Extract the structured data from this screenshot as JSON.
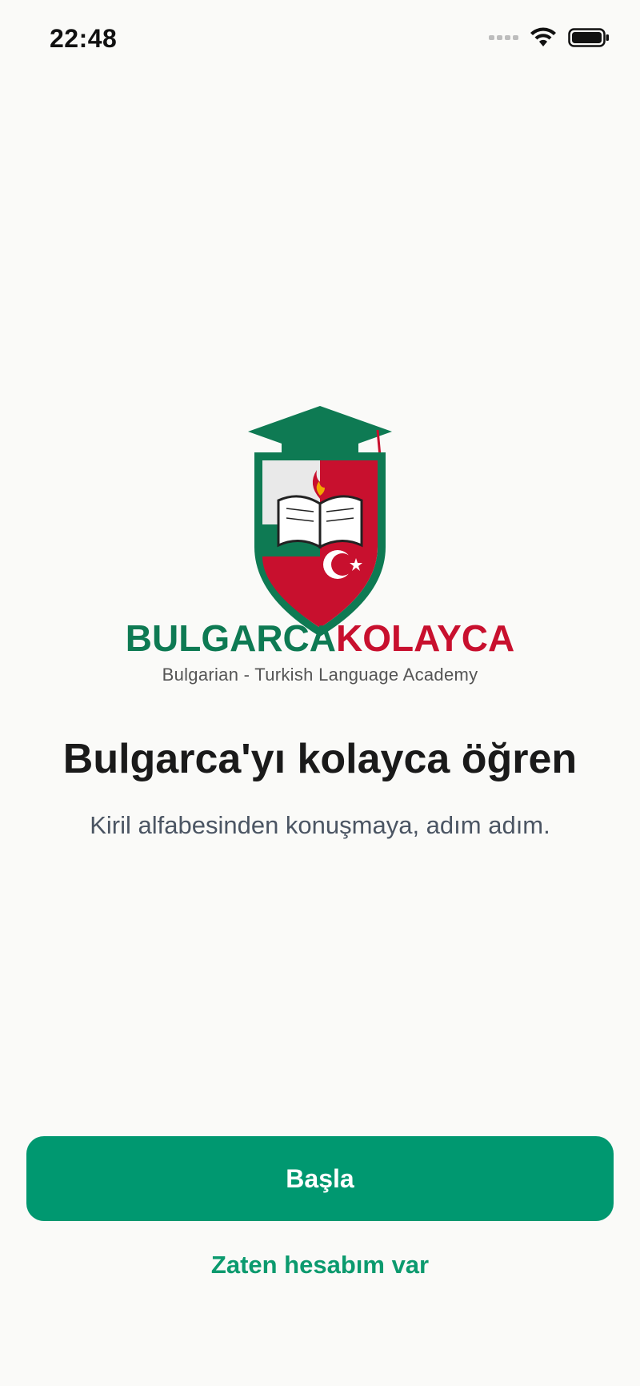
{
  "status_bar": {
    "time": "22:48",
    "icons": [
      "signal-icon",
      "wifi-icon",
      "battery-icon"
    ]
  },
  "logo": {
    "brand_part1": "BULGARCA",
    "brand_part2": "KOLAYCA",
    "subtitle": "Bulgarian - Turkish Language Academy",
    "colors": {
      "green": "#0E7A53",
      "red": "#C8102E"
    }
  },
  "main": {
    "headline": "Bulgarca'yı kolayca öğren",
    "subtitle": "Kiril alfabesinden konuşmaya, adım adım."
  },
  "actions": {
    "start_label": "Başla",
    "login_label": "Zaten hesabım var"
  },
  "colors": {
    "accent": "#009870",
    "background": "#FAFAF8"
  }
}
